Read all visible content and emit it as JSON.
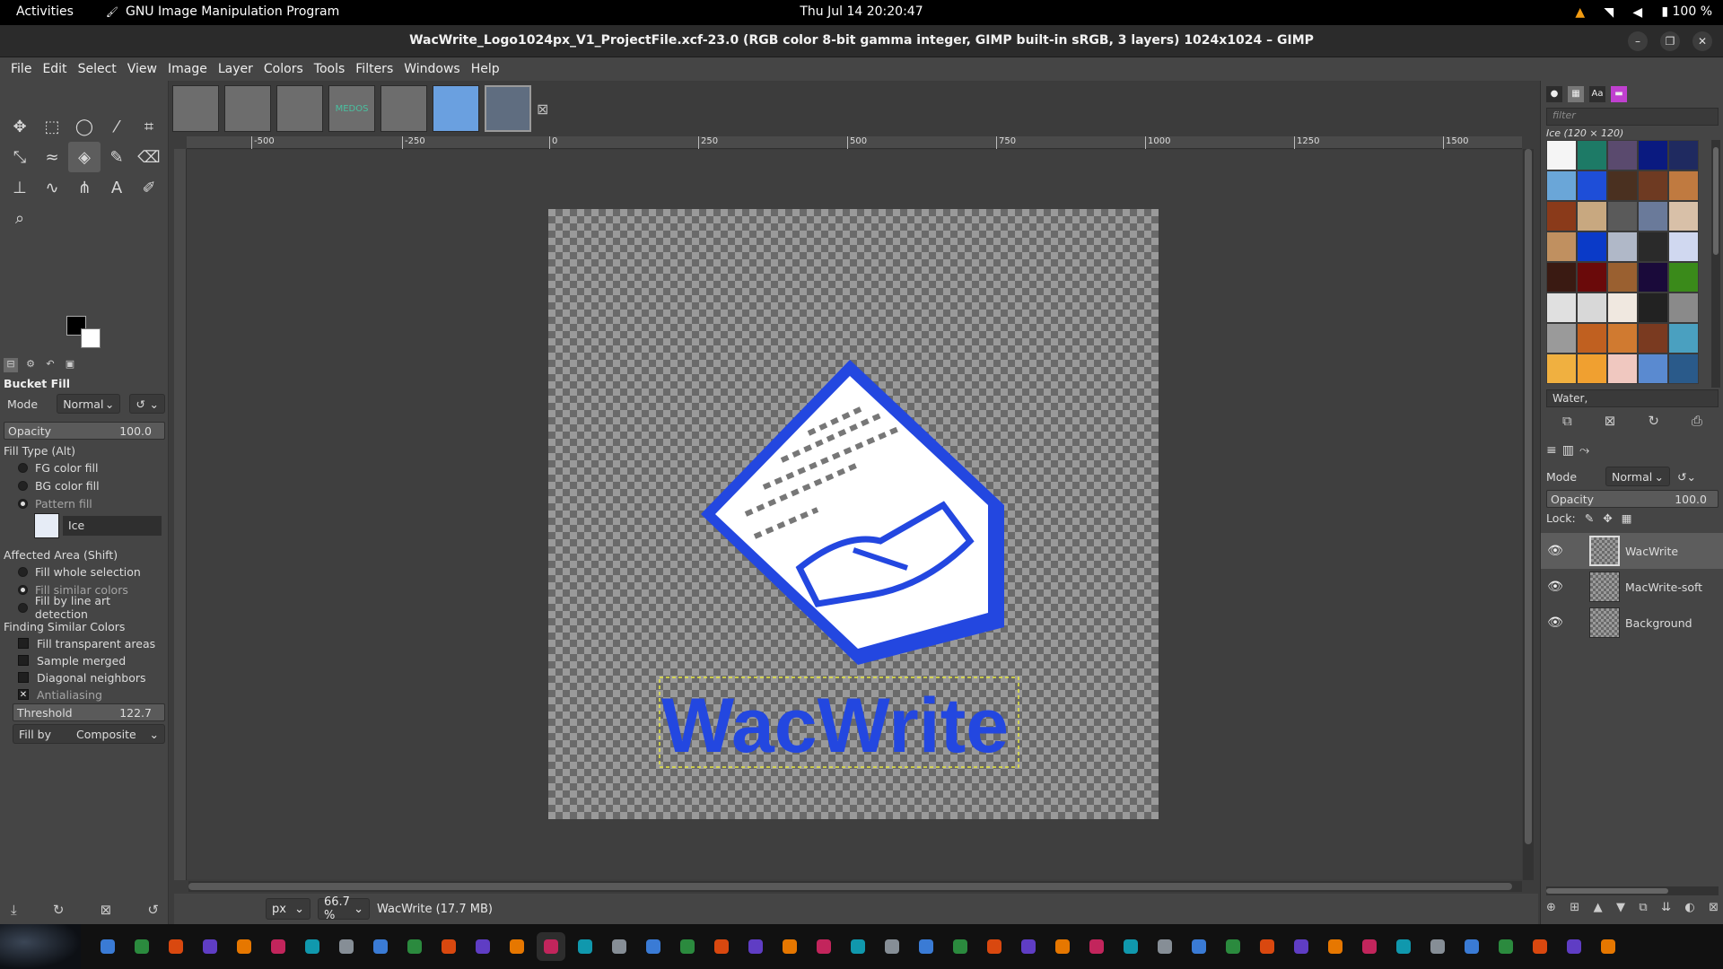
{
  "topbar": {
    "activities": "Activities",
    "app_name": "GNU Image Manipulation Program",
    "clock": "Thu Jul 14  20:20:47",
    "battery": "100 %"
  },
  "window": {
    "title": "WacWrite_Logo1024px_V1_ProjectFile.xcf-23.0 (RGB color 8-bit gamma integer, GIMP built-in sRGB, 3 layers) 1024x1024 – GIMP"
  },
  "menu": [
    "File",
    "Edit",
    "Select",
    "View",
    "Image",
    "Layer",
    "Colors",
    "Tools",
    "Filters",
    "Windows",
    "Help"
  ],
  "image_tabs": {
    "tabs": [
      "",
      "",
      "",
      "MEDOS",
      "",
      "",
      ""
    ]
  },
  "ruler": {
    "ticks": [
      "-500",
      "-250",
      "0",
      "250",
      "500",
      "750",
      "1000",
      "1250",
      "1500"
    ]
  },
  "tool_options": {
    "title": "Bucket Fill",
    "mode_label": "Mode",
    "mode_value": "Normal",
    "opacity_label": "Opacity",
    "opacity_value": "100.0",
    "fill_type_title": "Fill Type  (Alt)",
    "fill_types": [
      "FG color fill",
      "BG color fill",
      "Pattern fill"
    ],
    "selected_fill_type": "Pattern fill",
    "pattern_name": "Ice",
    "affected_title": "Affected Area  (Shift)",
    "affected": [
      "Fill whole selection",
      "Fill similar colors",
      "Fill by line art detection"
    ],
    "selected_affected": "Fill similar colors",
    "finding_title": "Finding Similar Colors",
    "finding": [
      {
        "label": "Fill transparent areas",
        "checked": false
      },
      {
        "label": "Sample merged",
        "checked": false
      },
      {
        "label": "Diagonal neighbors",
        "checked": false
      },
      {
        "label": "Antialiasing",
        "checked": true
      }
    ],
    "threshold_label": "Threshold",
    "threshold_value": "122.7",
    "fillby_label": "Fill by",
    "fillby_value": "Composite"
  },
  "canvas": {
    "logo_text": "WacWrite",
    "logo_color": "#2347e0"
  },
  "status": {
    "unit": "px",
    "zoom": "66.7 %",
    "info": "WacWrite (17.7 MB)"
  },
  "patterns": {
    "filter_placeholder": "filter",
    "selected_name": "Ice (120 × 120)",
    "brush_tag": "Water,",
    "swatches": [
      "#f5f5f5",
      "#1d7a66",
      "#5a4a6e",
      "#0a1a80",
      "#1f2a60",
      "#6aa6d8",
      "#1e4ed8",
      "#4a3020",
      "#6e3a22",
      "#c07a40",
      "#8a3a1a",
      "#c8a880",
      "#5a5a5a",
      "#6a7a9a",
      "#d8c0a8",
      "#c09060",
      "#0a3ac8",
      "#b0b8c8",
      "#2a2a2a",
      "#d0d8f0",
      "#3a1a12",
      "#6a0a0a",
      "#9a6030",
      "#1a0a3a",
      "#3a8a1a",
      "#e0e0e0",
      "#d8d8d8",
      "#f0e8e0",
      "#222222",
      "#8a8a8a",
      "#9a9a9a",
      "#c06020",
      "#d07a30",
      "#7a3a20",
      "#4aa0c0",
      "#f0b040",
      "#f0a030",
      "#f0c8c0",
      "#5a8ad0",
      "#2a5a8a"
    ]
  },
  "layers": {
    "mode_label": "Mode",
    "mode_value": "Normal",
    "opacity_label": "Opacity",
    "opacity_value": "100.0",
    "lock_label": "Lock:",
    "items": [
      {
        "name": "WacWrite",
        "visible": true,
        "active": true
      },
      {
        "name": "MacWrite-soft",
        "visible": true,
        "active": false
      },
      {
        "name": "Background",
        "visible": true,
        "active": false
      }
    ]
  },
  "dock_apps": [
    "terminal-icon",
    "files-icon",
    "docs-icon",
    "notes-icon",
    "console-icon",
    "firefox-icon",
    "vlc-icon",
    "chrome-icon",
    "help-icon",
    "store-icon",
    "editor-icon",
    "writer-icon",
    "monitor-icon",
    "gimp-icon",
    "cube-icon",
    "circle-icon",
    "inkscape-icon",
    "boat-icon",
    "game-icon",
    "text-icon",
    "viewer-icon",
    "browser-icon",
    "photos-icon",
    "sheet-icon",
    "camera-icon",
    "calc-icon",
    "draw-icon",
    "present-icon",
    "mail-icon",
    "discord-icon",
    "steam-icon",
    "pdf-icon",
    "link-icon",
    "record-icon",
    "tool-icon",
    "calendar-icon",
    "screen-icon",
    "vscode-icon",
    "obs-icon",
    "radio-icon",
    "word-icon",
    "impress-icon",
    "sheets-icon",
    "archive-icon",
    "grid-icon"
  ]
}
